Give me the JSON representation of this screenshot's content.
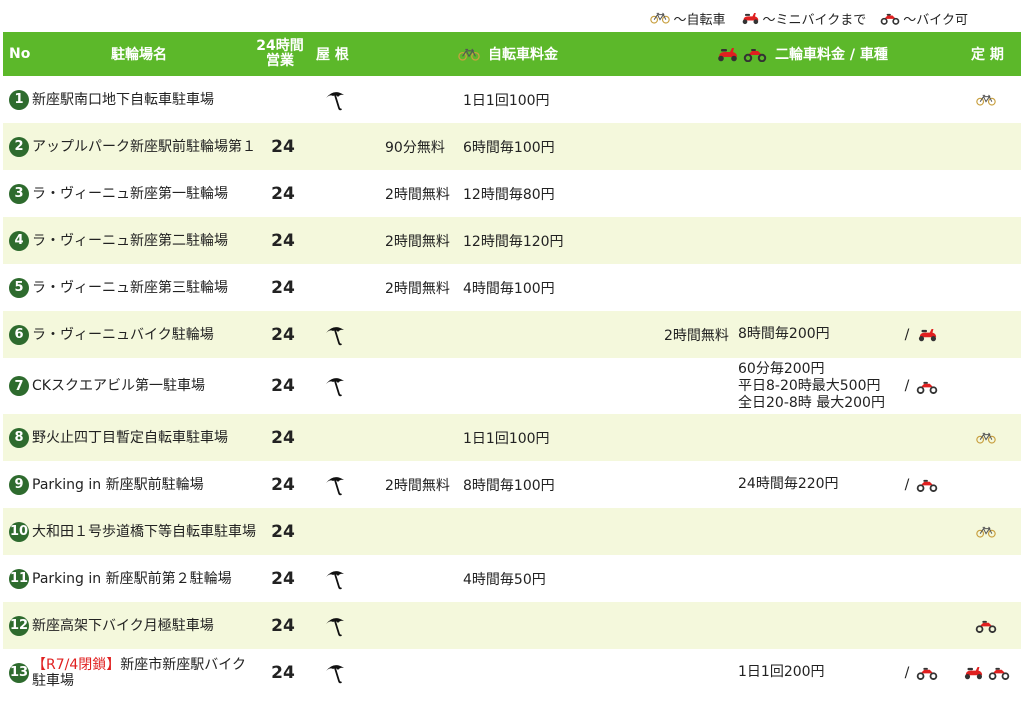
{
  "legend": [
    {
      "icon": "bicycle",
      "label": "〜自転車"
    },
    {
      "icon": "scooter",
      "label": "〜ミニバイクまで"
    },
    {
      "icon": "motorbike",
      "label": "〜バイク可"
    }
  ],
  "colors": {
    "header_bg": "#5cb82a",
    "alt_row_bg": "#f4f8dc",
    "number_badge": "#2e6b2e",
    "closed_text": "#e02020",
    "motorbike_red": "#e02020"
  },
  "header": {
    "no": "No",
    "name": "駐輪場名",
    "hours_line1": "24時間",
    "hours_line2": "営業",
    "roof": "屋 根",
    "bicycle_fee": "自転車料金",
    "motorbike_fee": "二輪車料金 / 車種",
    "pass": "定 期"
  },
  "rows": [
    {
      "no": "1",
      "closed": "",
      "name": "新座駅南口地下自転車駐車場",
      "h24": "",
      "roof": true,
      "bfree": "",
      "bfee": "1日1回100円",
      "mfree": "",
      "mfee": [],
      "slash": "",
      "mtype": "",
      "pass": [
        "bicycle"
      ]
    },
    {
      "no": "2",
      "closed": "",
      "name": "アップルパーク新座駅前駐輪場第１",
      "h24": "24",
      "roof": false,
      "bfree": "90分無料",
      "bfee": "6時間毎100円",
      "mfree": "",
      "mfee": [],
      "slash": "",
      "mtype": "",
      "pass": []
    },
    {
      "no": "3",
      "closed": "",
      "name": "ラ・ヴィーニュ新座第一駐輪場",
      "h24": "24",
      "roof": false,
      "bfree": "2時間無料",
      "bfee": "12時間毎80円",
      "mfree": "",
      "mfee": [],
      "slash": "",
      "mtype": "",
      "pass": []
    },
    {
      "no": "4",
      "closed": "",
      "name": "ラ・ヴィーニュ新座第二駐輪場",
      "h24": "24",
      "roof": false,
      "bfree": "2時間無料",
      "bfee": "12時間毎120円",
      "mfree": "",
      "mfee": [],
      "slash": "",
      "mtype": "",
      "pass": []
    },
    {
      "no": "5",
      "closed": "",
      "name": "ラ・ヴィーニュ新座第三駐輪場",
      "h24": "24",
      "roof": false,
      "bfree": "2時間無料",
      "bfee": "4時間毎100円",
      "mfree": "",
      "mfee": [],
      "slash": "",
      "mtype": "",
      "pass": []
    },
    {
      "no": "6",
      "closed": "",
      "name": "ラ・ヴィーニュバイク駐輪場",
      "h24": "24",
      "roof": true,
      "bfree": "",
      "bfee": "",
      "mfree": "2時間無料",
      "mfee": [
        "8時間毎200円"
      ],
      "slash": "/",
      "mtype": "scooter",
      "pass": []
    },
    {
      "no": "7",
      "closed": "",
      "name": "CKスクエアビル第一駐車場",
      "h24": "24",
      "roof": true,
      "bfree": "",
      "bfee": "",
      "mfree": "",
      "mfee": [
        "60分毎200円",
        "平日8-20時最大500円",
        "全日20-8時 最大200円"
      ],
      "slash": "/",
      "mtype": "motorbike",
      "pass": []
    },
    {
      "no": "8",
      "closed": "",
      "name": "野火止四丁目暫定自転車駐車場",
      "h24": "24",
      "roof": false,
      "bfree": "",
      "bfee": "1日1回100円",
      "mfree": "",
      "mfee": [],
      "slash": "",
      "mtype": "",
      "pass": [
        "bicycle"
      ]
    },
    {
      "no": "9",
      "closed": "",
      "name": "Parking in 新座駅前駐輪場",
      "h24": "24",
      "roof": true,
      "bfree": "2時間無料",
      "bfee": "8時間毎100円",
      "mfree": "",
      "mfee": [
        "24時間毎220円"
      ],
      "slash": "/",
      "mtype": "motorbike",
      "pass": []
    },
    {
      "no": "10",
      "closed": "",
      "name": "大和田１号歩道橋下等自転車駐車場",
      "h24": "24",
      "roof": false,
      "bfree": "",
      "bfee": "",
      "mfree": "",
      "mfee": [],
      "slash": "",
      "mtype": "",
      "pass": [
        "bicycle"
      ]
    },
    {
      "no": "11",
      "closed": "",
      "name": "Parking in 新座駅前第２駐輪場",
      "h24": "24",
      "roof": true,
      "bfree": "",
      "bfee": "4時間毎50円",
      "mfree": "",
      "mfee": [],
      "slash": "",
      "mtype": "",
      "pass": []
    },
    {
      "no": "12",
      "closed": "",
      "name": "新座高架下バイク月極駐車場",
      "h24": "24",
      "roof": true,
      "bfree": "",
      "bfee": "",
      "mfree": "",
      "mfee": [],
      "slash": "",
      "mtype": "",
      "pass": [
        "motorbike"
      ]
    },
    {
      "no": "13",
      "closed": "【R7/4閉鎖】",
      "name": "新座市新座駅バイク駐車場",
      "h24": "24",
      "roof": true,
      "bfree": "",
      "bfee": "",
      "mfree": "",
      "mfee": [
        "1日1回200円"
      ],
      "slash": "/",
      "mtype": "motorbike",
      "pass": [
        "scooter",
        "motorbike"
      ]
    }
  ]
}
